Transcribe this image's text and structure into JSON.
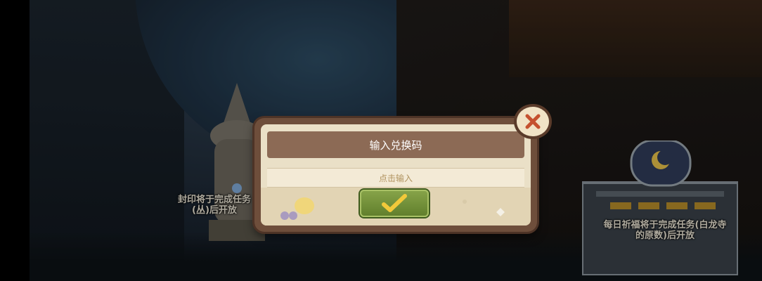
{
  "dialog": {
    "title": "输入兑换码",
    "input_placeholder": "点击输入"
  },
  "notices": {
    "left": "封印将于完成任务(丛)后开放",
    "right": "每日祈福将于完成任务(白龙寺的原数)后开放"
  },
  "colors": {
    "dialog_frame": "#6e4e3b",
    "title_bar": "#8c6a55",
    "confirm": "#6f8f33",
    "close_x": "#c5512f"
  },
  "icons": {
    "confirm": "checkmark-icon",
    "close": "close-icon"
  }
}
